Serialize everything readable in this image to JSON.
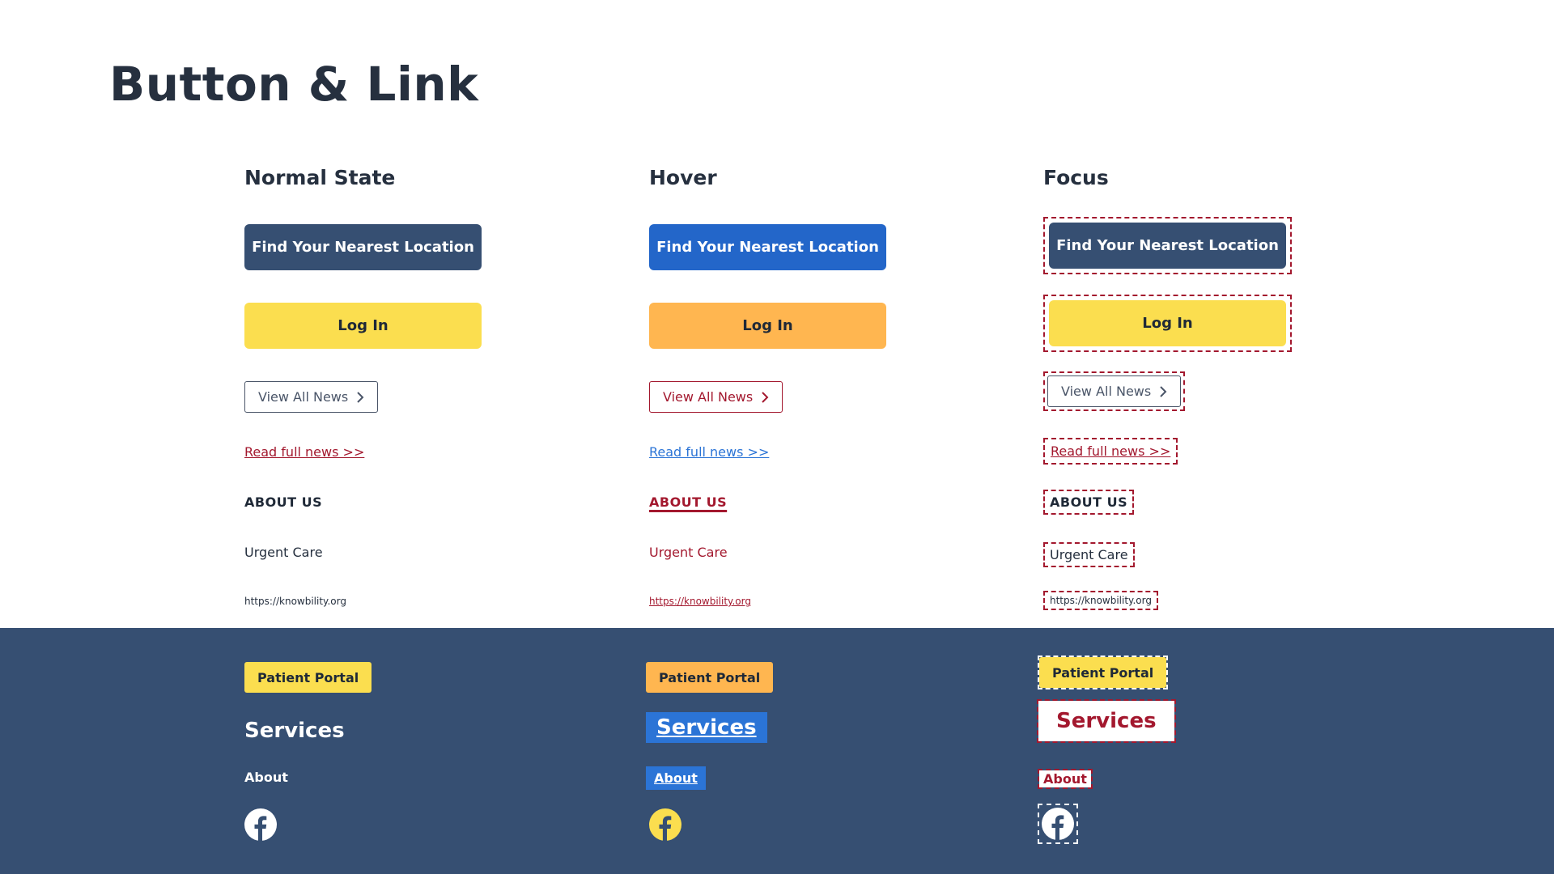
{
  "title": "Button & Link",
  "columns": [
    {
      "heading": "Normal State"
    },
    {
      "heading": "Hover"
    },
    {
      "heading": "Focus"
    }
  ],
  "buttons": {
    "find_location": "Find Your Nearest Location",
    "login": "Log In",
    "view_news": "View All News"
  },
  "links": {
    "read_news": "Read full news >>",
    "about_us": "ABOUT US",
    "urgent_care": "Urgent Care",
    "url": "https://knowbility.org"
  },
  "footer": {
    "patient_portal": "Patient Portal",
    "services": "Services",
    "about": "About"
  },
  "icons": {
    "chevron": "chevron-right-icon",
    "facebook": "facebook-icon"
  },
  "colors": {
    "primary_navy": "#364f72",
    "hover_blue": "#2366c9",
    "yellow": "#fbde4f",
    "hover_orange": "#ffb650",
    "focus_red": "#a3182e",
    "link_blue": "#2b74d6"
  }
}
